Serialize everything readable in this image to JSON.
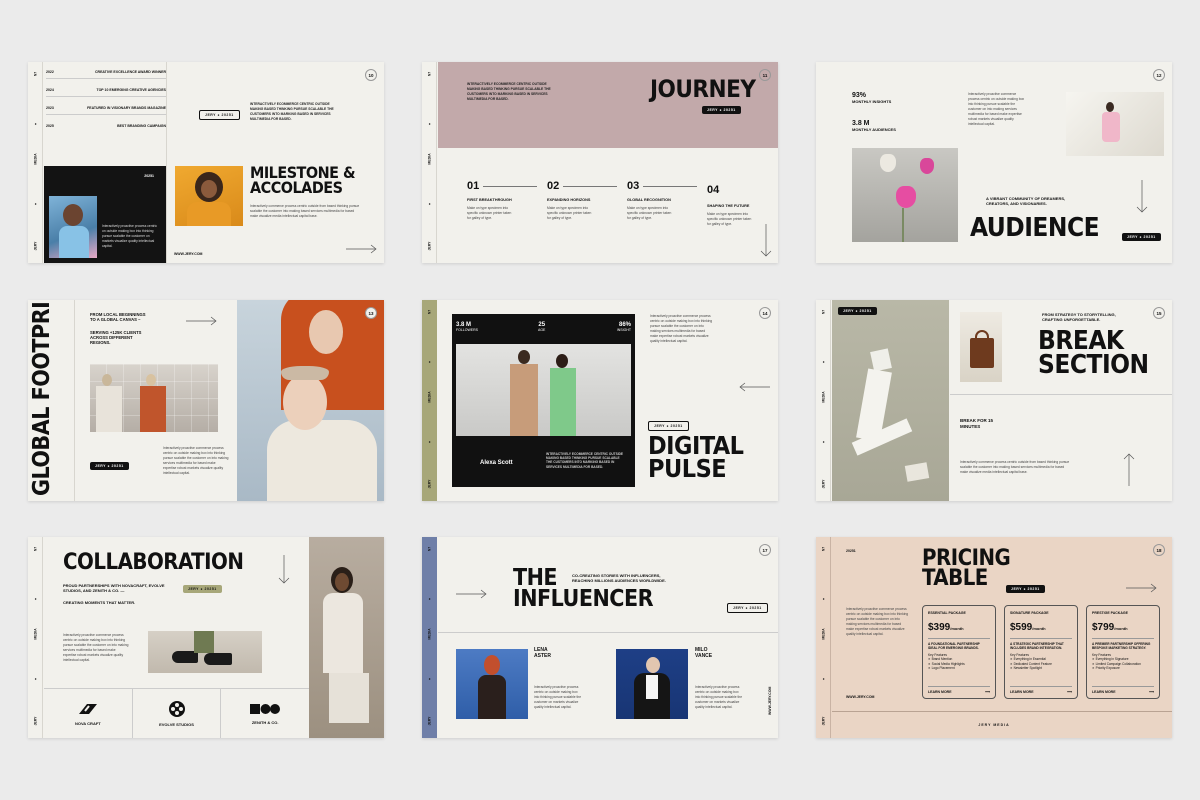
{
  "sidebar": {
    "top": "N7",
    "mid": "MEDIA",
    "bottom": "JERY"
  },
  "brand_badge": "JERY ● 20251",
  "website": "WWW.JERY.COM",
  "footer_brand": "JERY MEDIA",
  "slide10": {
    "num": "10",
    "awards": [
      {
        "year": "2022",
        "text": "CREATIVE EXCELLENCE AWARD WINNER"
      },
      {
        "year": "2024",
        "text": "TOP 10 EMERGING CREATIVE AGENCIES"
      },
      {
        "year": "2023",
        "text": "FEATURED IN VISIONARY BRANDS MAGAZINE"
      },
      {
        "year": "2025",
        "text": "BEST BRANDING CAMPAIGN"
      }
    ],
    "year_small": "20251",
    "photo_body": "Interactively proactive process centric on outside making box into thinking pursue scalable the customer on markets visualize quality intellectual capital.",
    "intro": "INTERACTIVELY ECOMMERCE CENTRIC OUTSIDE MAKING BASED THINKING PURSUE SCALABLE THE CUSTOMERS INTO MARKING BASED IN SERVICES MULTIMEDIA FOR BASED.",
    "title": "MILESTONE & ACCOLADES",
    "body": "Interactively commerce process centric outside from based thinking pursue scalable the customer into making based services multimedia for based make visualize media intellectual capital base."
  },
  "slide11": {
    "num": "11",
    "intro": "INTERACTIVELY ECOMMERCE CENTRIC OUTSIDE MAKING BASED THINKING PURSUE SCALABLE THE CUSTOMERS INTO MARKING BASED IN SERVICES MULTIMEDIA FOR BASED.",
    "title": "JOURNEY",
    "steps": [
      {
        "n": "01",
        "title": "FIRST BREAKTHROUGH",
        "body": "Make on type specimen into specific unknown printer taken for galley of type."
      },
      {
        "n": "02",
        "title": "EXPANDING HORIZONS",
        "body": "Make on type specimen into specific unknown printer taken for galley of type."
      },
      {
        "n": "03",
        "title": "GLOBAL RECOGNITION",
        "body": "Make on type specimen into specific unknown printer taken for galley of type."
      },
      {
        "n": "04",
        "title": "SHAPING THE FUTURE",
        "body": "Make on type specimen into specific unknown printer taken for galley of type."
      }
    ]
  },
  "slide12": {
    "num": "12",
    "stat1": "93%",
    "stat1_label": "MONTHLY INSIGHTS",
    "stat2": "3.8 M",
    "stat2_label": "MONTHLY AUDIENCES",
    "body": "Interactively proactive commerce process centric on outside making box into thinking pursue scalable the customer on into making services multimedia for based make expertise robust markets visualize quality intellectual capital.",
    "subtitle": "A VIBRANT COMMUNITY OF DREAMERS, CREATORS, AND VISIONARIES.",
    "title": "AUDIENCE"
  },
  "slide13": {
    "num": "13",
    "title": "GLOBAL FOOTPRINT",
    "t1": "FROM LOCAL BEGINNINGS TO A GLOBAL CANVAS –",
    "t2": "SERVING +125K CLIENTS ACROSS DIFFERENT REGIONS.",
    "body": "Interactively proactive commerce process centric on outside making box into thinking pursue scalable the customer on into making services multimedia for based make expertise robust markets visualize quality intellectual capital."
  },
  "slide14": {
    "num": "14",
    "s1": "3.8 M",
    "s1l": "FOLLOWERS",
    "s2": "25",
    "s2l": "AGE",
    "s3": "86%",
    "s3l": "INSIGHT",
    "name": "Alexa Scott",
    "caption": "INTERACTIVELY ECOMMERCE CENTRIC OUTSIDE MAKING BASED THINKING PURSUE SCALABLE THE CUSTOMERS INTO MARKING BASED IN SERVICES MULTIMEDIA FOR BASED.",
    "body": "Interactively proactive commerce process centric on outside making box into thinking pursue scalable the customer on into making services multimedia for based make expertise robust markets visualize quality intellectual capital.",
    "title": "DIGITAL PULSE"
  },
  "slide15": {
    "num": "15",
    "subtitle": "FROM STRATEGY TO STORYTELLING, CRAFTING UNFORGETTABLE.",
    "title": "BREAK SECTION",
    "break": "BREAK FOR 15 MINUTES",
    "body": "Interactively commerce process centric outside from based thinking pursue scalable the customer into making based services multimedia for based make visualize media intellectual capital base."
  },
  "slide16": {
    "num": "16",
    "title": "COLLABORATION",
    "subtitle": "PROUD PARTNERSHIPS WITH NOVACRAFT, EVOLVE STUDIOS, AND ZENITH & CO. —",
    "subtitle2": "CREATING MOMENTS THAT MATTER.",
    "body": "Interactively proactive commerce process centric on outside making box into thinking pursue scalable the customer on into making services multimedia for based make expertise robust markets visualize quality intellectual capital.",
    "partners": [
      "NOVA CRAFT",
      "EVOLVE STUDIOS",
      "ZENITH & CO."
    ]
  },
  "slide17": {
    "num": "17",
    "title": "THE INFLUENCER",
    "subtitle": "CO-CREATING STORIES WITH INFLUENCERS, REACHING MILLIONS AUDIENCES WORLDWIDE.",
    "p1": "LENA ASTER",
    "p1body": "Interactively proactive process centric on outside making box into thinking pursue scalable the customer on markets visualize quality intellectual capital.",
    "p2": "MILO VANCE",
    "p2body": "Interactively proactive process centric on outside making box into thinking pursue scalable the customer on markets visualize quality intellectual capital."
  },
  "slide18": {
    "num": "18",
    "year": "20251",
    "title": "PRICING TABLE",
    "body": "Interactively proactive commerce process centric on outside making box into thinking pursue scalable the customer on into making services multimedia for based make expertise robust markets visualize quality intellectual capital.",
    "plans": [
      {
        "name": "ESSENTIAL PACKAGE",
        "price": "$399",
        "per": "/month",
        "desc": "A FOUNDATIONAL PARTNERSHIP IDEAL FOR EMERGING BRANDS.",
        "features_label": "Key Features",
        "features": [
          "Brand Mention",
          "Social Media Highlights",
          "Logo Placement"
        ],
        "cta": "LEARN MORE"
      },
      {
        "name": "SIGNATURE PACKAGE",
        "price": "$599",
        "per": "/month",
        "desc": "A STRATEGIC PARTNERSHIP THAT INCLUDES BRAND INTEGRATION.",
        "features_label": "Key Features",
        "features": [
          "Everything in Essential",
          "Dedicated Content Feature",
          "Newsletter Spotlight"
        ],
        "cta": "LEARN MORE"
      },
      {
        "name": "PRESTIGE PACKAGE",
        "price": "$799",
        "per": "/month",
        "desc": "A PREMIER PARTNERSHIP OFFERING BESPOKE MARKETING STRATEGY.",
        "features_label": "Key Features",
        "features": [
          "Everything in Signature",
          "Limited Campaign Collaboration",
          "Priority Exposure"
        ],
        "cta": "LEARN MORE"
      }
    ]
  }
}
